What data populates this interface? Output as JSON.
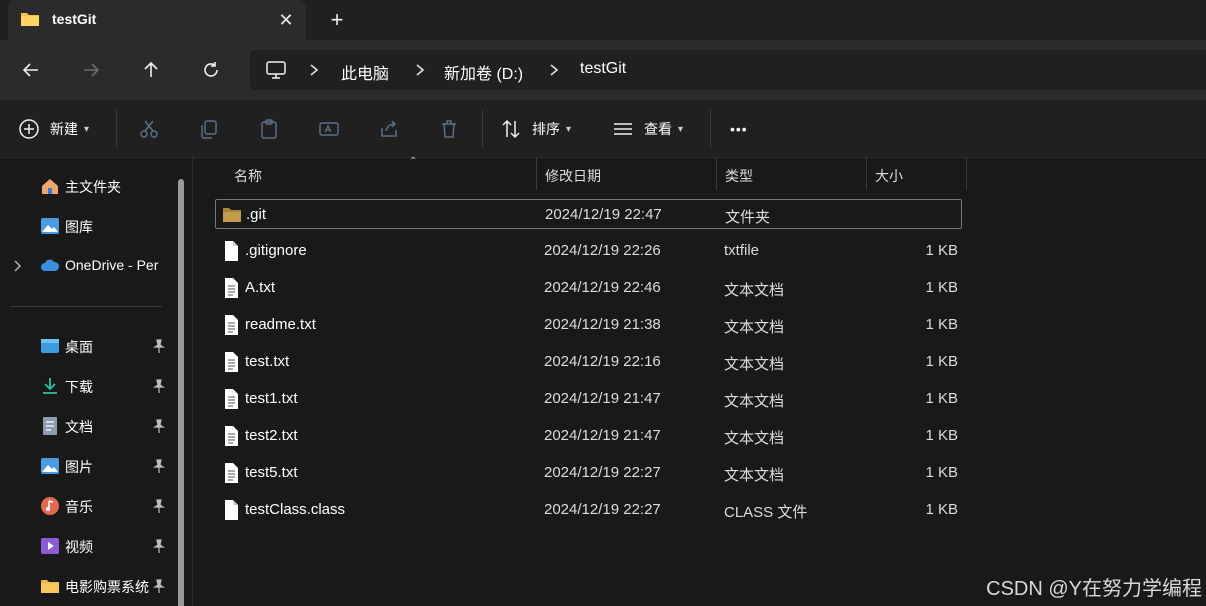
{
  "tab": {
    "title": "testGit",
    "close": "✕",
    "new_tab": "+"
  },
  "breadcrumb": [
    "此电脑",
    "新加卷 (D:)",
    "testGit"
  ],
  "toolbar": {
    "new_label": "新建",
    "sort_label": "排序",
    "view_label": "查看",
    "more": "•••"
  },
  "sidebar": {
    "items": [
      {
        "label": "主文件夹",
        "icon": "home-icon",
        "pinned": false
      },
      {
        "label": "图库",
        "icon": "gallery-icon",
        "pinned": false
      },
      {
        "label": "OneDrive - Per",
        "icon": "cloud-icon",
        "pinned": false,
        "expandable": true
      },
      {
        "label": "桌面",
        "icon": "desktop-icon",
        "pinned": true
      },
      {
        "label": "下载",
        "icon": "download-icon",
        "pinned": true
      },
      {
        "label": "文档",
        "icon": "document-icon",
        "pinned": true
      },
      {
        "label": "图片",
        "icon": "pictures-icon",
        "pinned": true
      },
      {
        "label": "音乐",
        "icon": "music-icon",
        "pinned": true
      },
      {
        "label": "视频",
        "icon": "video-icon",
        "pinned": true
      },
      {
        "label": "电影购票系统",
        "icon": "folder-icon",
        "pinned": true
      }
    ]
  },
  "columns": {
    "name": "名称",
    "date": "修改日期",
    "type": "类型",
    "size": "大小"
  },
  "files": [
    {
      "name": ".git",
      "date": "2024/12/19 22:47",
      "type": "文件夹",
      "size": "",
      "icon": "folder-icon"
    },
    {
      "name": ".gitignore",
      "date": "2024/12/19 22:26",
      "type": "txtfile",
      "size": "1 KB",
      "icon": "file-icon"
    },
    {
      "name": "A.txt",
      "date": "2024/12/19 22:46",
      "type": "文本文档",
      "size": "1 KB",
      "icon": "text-file-icon"
    },
    {
      "name": "readme.txt",
      "date": "2024/12/19 21:38",
      "type": "文本文档",
      "size": "1 KB",
      "icon": "text-file-icon"
    },
    {
      "name": "test.txt",
      "date": "2024/12/19 22:16",
      "type": "文本文档",
      "size": "1 KB",
      "icon": "text-file-icon"
    },
    {
      "name": "test1.txt",
      "date": "2024/12/19 21:47",
      "type": "文本文档",
      "size": "1 KB",
      "icon": "text-file-icon"
    },
    {
      "name": "test2.txt",
      "date": "2024/12/19 21:47",
      "type": "文本文档",
      "size": "1 KB",
      "icon": "text-file-icon"
    },
    {
      "name": "test5.txt",
      "date": "2024/12/19 22:27",
      "type": "文本文档",
      "size": "1 KB",
      "icon": "text-file-icon"
    },
    {
      "name": "testClass.class",
      "date": "2024/12/19 22:27",
      "type": "CLASS 文件",
      "size": "1 KB",
      "icon": "file-icon"
    }
  ],
  "watermark": "CSDN @Y在努力学编程",
  "colors": {
    "background": "#191919",
    "toolbar": "#202020",
    "nav": "#2b2b2b",
    "folder": "#e8b44a"
  }
}
